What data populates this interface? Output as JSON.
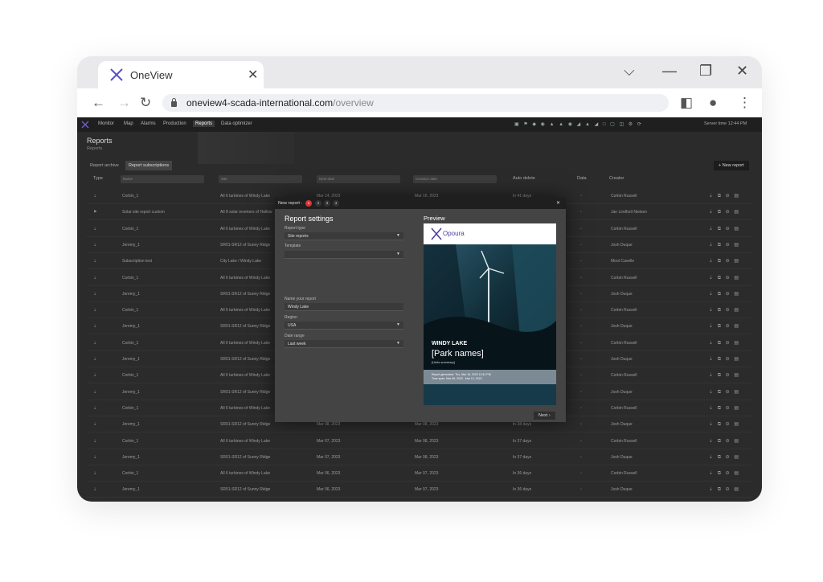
{
  "browser": {
    "tab_title": "OneView",
    "url_host": "oneview4-scada-international.com",
    "url_path": "/overview"
  },
  "app": {
    "nav": [
      "Monitor",
      "Map",
      "Alarms",
      "Production",
      "Reports",
      "Data optimizer"
    ],
    "active_nav": "Reports",
    "server_time": "Server time 12:44 PM",
    "page_title": "Reports",
    "breadcrumb": "Reports",
    "subtabs": [
      "Report archive",
      "Report subscriptions"
    ],
    "new_report": "+ New report",
    "columns": {
      "type": "Type",
      "name": "Name",
      "site": "Site",
      "next": "Next date",
      "created": "Creation date",
      "auto": "Auto delete",
      "data": "Data",
      "creator": "Creator"
    },
    "rows": [
      {
        "name": "Corbin_1",
        "site": "All 6 turbines of Windy Lake",
        "next": "Mar 14, 2023",
        "created": "Mar 16, 2023",
        "auto": "In 41 days",
        "creator": "Corbin Russell"
      },
      {
        "name": "Solar site report custom",
        "site": "All 8 solar inverters of Hallow",
        "next": "",
        "created": "",
        "auto": "",
        "creator": "Jan Lindholt Nielsen"
      },
      {
        "name": "Corbin_1",
        "site": "All 6 turbines of Windy Lake",
        "next": "",
        "created": "",
        "auto": "",
        "creator": "Corbin Russell"
      },
      {
        "name": "Jeremy_1",
        "site": "SR01-SR12 of Sunny Ridge",
        "next": "",
        "created": "",
        "auto": "",
        "creator": "Josh Duque"
      },
      {
        "name": "Subscription test",
        "site": "City Lake / Windy Lake",
        "next": "",
        "created": "",
        "auto": "",
        "creator": "Moot Cavelle"
      },
      {
        "name": "Corbin_1",
        "site": "All 6 turbines of Windy Lake",
        "next": "",
        "created": "",
        "auto": "",
        "creator": "Corbin Russell"
      },
      {
        "name": "Jeremy_1",
        "site": "SR01-SR12 of Sunny Ridge",
        "next": "",
        "created": "",
        "auto": "",
        "creator": "Josh Duque"
      },
      {
        "name": "Corbin_1",
        "site": "All 6 turbines of Windy Lake",
        "next": "",
        "created": "",
        "auto": "",
        "creator": "Corbin Russell"
      },
      {
        "name": "Jeremy_1",
        "site": "SR01-SR12 of Sunny Ridge",
        "next": "",
        "created": "",
        "auto": "",
        "creator": "Josh Duque"
      },
      {
        "name": "Corbin_1",
        "site": "All 6 turbines of Windy Lake",
        "next": "",
        "created": "",
        "auto": "",
        "creator": "Corbin Russell"
      },
      {
        "name": "Jeremy_1",
        "site": "SR01-SR12 of Sunny Ridge",
        "next": "",
        "created": "",
        "auto": "",
        "creator": "Josh Duque"
      },
      {
        "name": "Corbin_1",
        "site": "All 6 turbines of Windy Lake",
        "next": "",
        "created": "",
        "auto": "",
        "creator": "Corbin Russell"
      },
      {
        "name": "Jeremy_1",
        "site": "SR01-SR12 of Sunny Ridge",
        "next": "",
        "created": "",
        "auto": "",
        "creator": "Josh Duque"
      },
      {
        "name": "Corbin_1",
        "site": "All 6 turbines of Windy Lake",
        "next": "",
        "created": "",
        "auto": "",
        "creator": "Corbin Russell"
      },
      {
        "name": "Jeremy_1",
        "site": "SR01-SR12 of Sunny Ridge",
        "next": "Mar 08, 2023",
        "created": "Mar 08, 2023",
        "auto": "In 38 days",
        "creator": "Josh Duque"
      },
      {
        "name": "Corbin_1",
        "site": "All 6 turbines of Windy Lake",
        "next": "Mar 07, 2023",
        "created": "Mar 08, 2023",
        "auto": "In 37 days",
        "creator": "Corbin Russell"
      },
      {
        "name": "Jeremy_1",
        "site": "SR01-SR12 of Sunny Ridge",
        "next": "Mar 07, 2023",
        "created": "Mar 08, 2023",
        "auto": "In 37 days",
        "creator": "Josh Duque"
      },
      {
        "name": "Corbin_1",
        "site": "All 6 turbines of Windy Lake",
        "next": "Mar 06, 2023",
        "created": "Mar 07, 2023",
        "auto": "In 36 days",
        "creator": "Corbin Russell"
      },
      {
        "name": "Jeremy_1",
        "site": "SR01-SR12 of Sunny Ridge",
        "next": "Mar 06, 2023",
        "created": "Mar 07, 2023",
        "auto": "In 36 days",
        "creator": "Josh Duque"
      }
    ]
  },
  "modal": {
    "title": "New report -",
    "steps": [
      "1",
      "2",
      "3",
      "4"
    ],
    "settings_title": "Report settings",
    "report_type_label": "Report type",
    "report_type_value": "Site reports",
    "template_label": "Template",
    "template_value": "",
    "name_label": "Name your report",
    "name_value": "Windy Lake",
    "region_label": "Region",
    "region_value": "USA",
    "date_label": "Date range",
    "date_value": "Last week",
    "preview_title": "Preview",
    "preview_brand": "Opoura",
    "preview_h1": "WINDY LAKE",
    "preview_h2": "[Park names]",
    "preview_h3": "[Units summary]",
    "preview_m1": "Report generated: Thu, Mar 16, 2023 12:41 PM",
    "preview_m2": "Time span: Mar 06, 2023 - Mar 12, 2023",
    "next_label": "Next"
  }
}
